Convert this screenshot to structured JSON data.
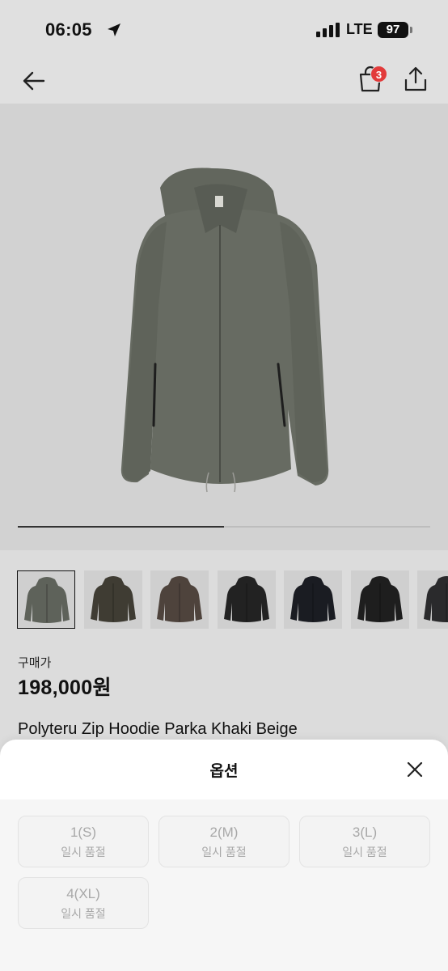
{
  "status_bar": {
    "time": "06:05",
    "network": "LTE",
    "battery": "97"
  },
  "nav": {
    "cart_count": "3",
    "icons": [
      "arrow-left-icon",
      "shopping-bag-icon",
      "share-icon"
    ]
  },
  "gallery": {
    "progress": 0.5,
    "thumbnail_count": 7,
    "thumbnail_colors": [
      "#5e625a",
      "#3f3c33",
      "#4e433c",
      "#222222",
      "#1a1c22",
      "#1e1e1e",
      "#2a2a2c"
    ]
  },
  "product": {
    "price_label": "구매가",
    "price": "198,000원",
    "name": "Polyteru Zip Hoodie Parka Khaki Beige"
  },
  "option_sheet": {
    "title": "옵션",
    "options": [
      {
        "size": "1(S)",
        "status": "일시 품절"
      },
      {
        "size": "2(M)",
        "status": "일시 품절"
      },
      {
        "size": "3(L)",
        "status": "일시 품절"
      },
      {
        "size": "4(XL)",
        "status": "일시 품절"
      }
    ]
  }
}
